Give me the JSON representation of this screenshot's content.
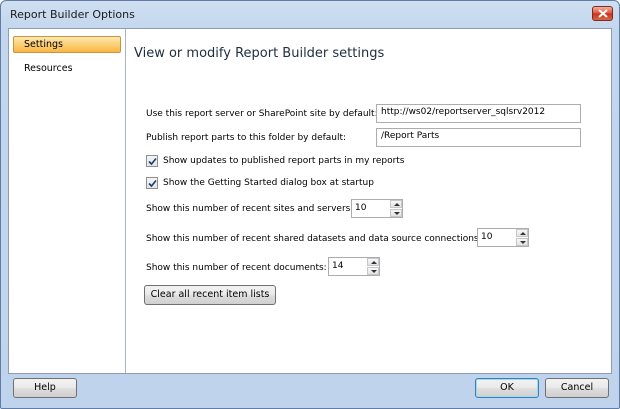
{
  "window": {
    "title": "Report Builder Options"
  },
  "nav": {
    "items": [
      {
        "label": "Settings",
        "selected": true
      },
      {
        "label": "Resources",
        "selected": false
      }
    ]
  },
  "content": {
    "heading": "View or modify Report Builder settings",
    "server_label": "Use this report server or SharePoint site by default:",
    "server_value": "http://ws02/reportserver_sqlsrv2012",
    "folder_label": "Publish report parts to this folder by default:",
    "folder_value": "/Report Parts",
    "check_updates_label": "Show updates to published report parts in my reports",
    "check_updates_checked": true,
    "check_getting_started_label": "Show the Getting Started dialog box at startup",
    "check_getting_started_checked": true,
    "recent_sites_label": "Show this number of recent sites and servers:",
    "recent_sites_value": "10",
    "recent_datasets_label": "Show this number of recent shared datasets and data source connections:",
    "recent_datasets_value": "10",
    "recent_docs_label": "Show this number of recent documents:",
    "recent_docs_value": "14",
    "clear_button": "Clear all recent item lists"
  },
  "footer": {
    "help_label": "Help",
    "ok_label": "OK",
    "cancel_label": "Cancel"
  },
  "colors": {
    "selection": "#f9b642",
    "close_button": "#d9473a",
    "window_frame": "#c2d6ee"
  }
}
